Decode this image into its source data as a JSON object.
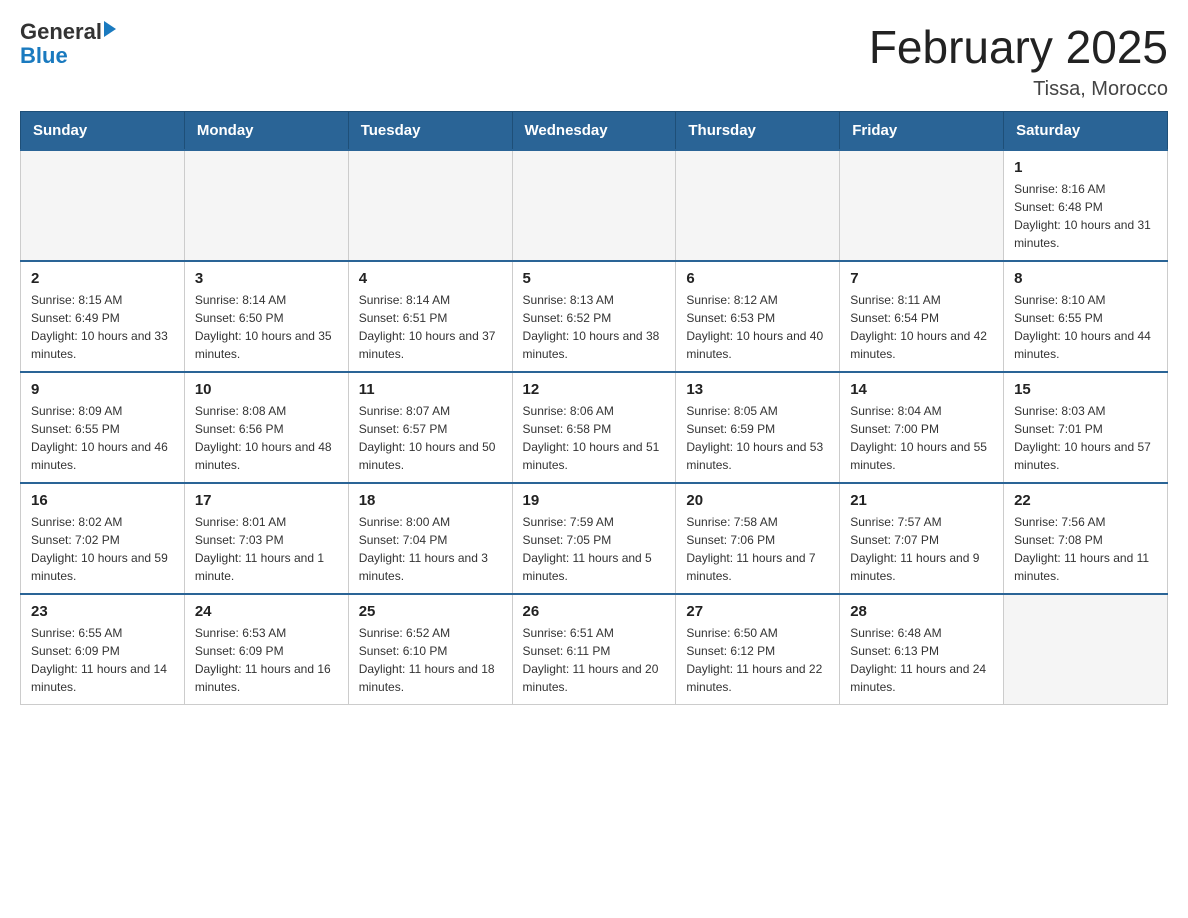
{
  "header": {
    "logo": {
      "general": "General",
      "blue": "Blue"
    },
    "title": "February 2025",
    "subtitle": "Tissa, Morocco"
  },
  "days_of_week": [
    "Sunday",
    "Monday",
    "Tuesday",
    "Wednesday",
    "Thursday",
    "Friday",
    "Saturday"
  ],
  "weeks": [
    {
      "days": [
        {
          "number": "",
          "info": "",
          "empty": true
        },
        {
          "number": "",
          "info": "",
          "empty": true
        },
        {
          "number": "",
          "info": "",
          "empty": true
        },
        {
          "number": "",
          "info": "",
          "empty": true
        },
        {
          "number": "",
          "info": "",
          "empty": true
        },
        {
          "number": "",
          "info": "",
          "empty": true
        },
        {
          "number": "1",
          "info": "Sunrise: 8:16 AM\nSunset: 6:48 PM\nDaylight: 10 hours and 31 minutes.",
          "empty": false
        }
      ]
    },
    {
      "days": [
        {
          "number": "2",
          "info": "Sunrise: 8:15 AM\nSunset: 6:49 PM\nDaylight: 10 hours and 33 minutes.",
          "empty": false
        },
        {
          "number": "3",
          "info": "Sunrise: 8:14 AM\nSunset: 6:50 PM\nDaylight: 10 hours and 35 minutes.",
          "empty": false
        },
        {
          "number": "4",
          "info": "Sunrise: 8:14 AM\nSunset: 6:51 PM\nDaylight: 10 hours and 37 minutes.",
          "empty": false
        },
        {
          "number": "5",
          "info": "Sunrise: 8:13 AM\nSunset: 6:52 PM\nDaylight: 10 hours and 38 minutes.",
          "empty": false
        },
        {
          "number": "6",
          "info": "Sunrise: 8:12 AM\nSunset: 6:53 PM\nDaylight: 10 hours and 40 minutes.",
          "empty": false
        },
        {
          "number": "7",
          "info": "Sunrise: 8:11 AM\nSunset: 6:54 PM\nDaylight: 10 hours and 42 minutes.",
          "empty": false
        },
        {
          "number": "8",
          "info": "Sunrise: 8:10 AM\nSunset: 6:55 PM\nDaylight: 10 hours and 44 minutes.",
          "empty": false
        }
      ]
    },
    {
      "days": [
        {
          "number": "9",
          "info": "Sunrise: 8:09 AM\nSunset: 6:55 PM\nDaylight: 10 hours and 46 minutes.",
          "empty": false
        },
        {
          "number": "10",
          "info": "Sunrise: 8:08 AM\nSunset: 6:56 PM\nDaylight: 10 hours and 48 minutes.",
          "empty": false
        },
        {
          "number": "11",
          "info": "Sunrise: 8:07 AM\nSunset: 6:57 PM\nDaylight: 10 hours and 50 minutes.",
          "empty": false
        },
        {
          "number": "12",
          "info": "Sunrise: 8:06 AM\nSunset: 6:58 PM\nDaylight: 10 hours and 51 minutes.",
          "empty": false
        },
        {
          "number": "13",
          "info": "Sunrise: 8:05 AM\nSunset: 6:59 PM\nDaylight: 10 hours and 53 minutes.",
          "empty": false
        },
        {
          "number": "14",
          "info": "Sunrise: 8:04 AM\nSunset: 7:00 PM\nDaylight: 10 hours and 55 minutes.",
          "empty": false
        },
        {
          "number": "15",
          "info": "Sunrise: 8:03 AM\nSunset: 7:01 PM\nDaylight: 10 hours and 57 minutes.",
          "empty": false
        }
      ]
    },
    {
      "days": [
        {
          "number": "16",
          "info": "Sunrise: 8:02 AM\nSunset: 7:02 PM\nDaylight: 10 hours and 59 minutes.",
          "empty": false
        },
        {
          "number": "17",
          "info": "Sunrise: 8:01 AM\nSunset: 7:03 PM\nDaylight: 11 hours and 1 minute.",
          "empty": false
        },
        {
          "number": "18",
          "info": "Sunrise: 8:00 AM\nSunset: 7:04 PM\nDaylight: 11 hours and 3 minutes.",
          "empty": false
        },
        {
          "number": "19",
          "info": "Sunrise: 7:59 AM\nSunset: 7:05 PM\nDaylight: 11 hours and 5 minutes.",
          "empty": false
        },
        {
          "number": "20",
          "info": "Sunrise: 7:58 AM\nSunset: 7:06 PM\nDaylight: 11 hours and 7 minutes.",
          "empty": false
        },
        {
          "number": "21",
          "info": "Sunrise: 7:57 AM\nSunset: 7:07 PM\nDaylight: 11 hours and 9 minutes.",
          "empty": false
        },
        {
          "number": "22",
          "info": "Sunrise: 7:56 AM\nSunset: 7:08 PM\nDaylight: 11 hours and 11 minutes.",
          "empty": false
        }
      ]
    },
    {
      "days": [
        {
          "number": "23",
          "info": "Sunrise: 6:55 AM\nSunset: 6:09 PM\nDaylight: 11 hours and 14 minutes.",
          "empty": false
        },
        {
          "number": "24",
          "info": "Sunrise: 6:53 AM\nSunset: 6:09 PM\nDaylight: 11 hours and 16 minutes.",
          "empty": false
        },
        {
          "number": "25",
          "info": "Sunrise: 6:52 AM\nSunset: 6:10 PM\nDaylight: 11 hours and 18 minutes.",
          "empty": false
        },
        {
          "number": "26",
          "info": "Sunrise: 6:51 AM\nSunset: 6:11 PM\nDaylight: 11 hours and 20 minutes.",
          "empty": false
        },
        {
          "number": "27",
          "info": "Sunrise: 6:50 AM\nSunset: 6:12 PM\nDaylight: 11 hours and 22 minutes.",
          "empty": false
        },
        {
          "number": "28",
          "info": "Sunrise: 6:48 AM\nSunset: 6:13 PM\nDaylight: 11 hours and 24 minutes.",
          "empty": false
        },
        {
          "number": "",
          "info": "",
          "empty": true
        }
      ]
    }
  ]
}
